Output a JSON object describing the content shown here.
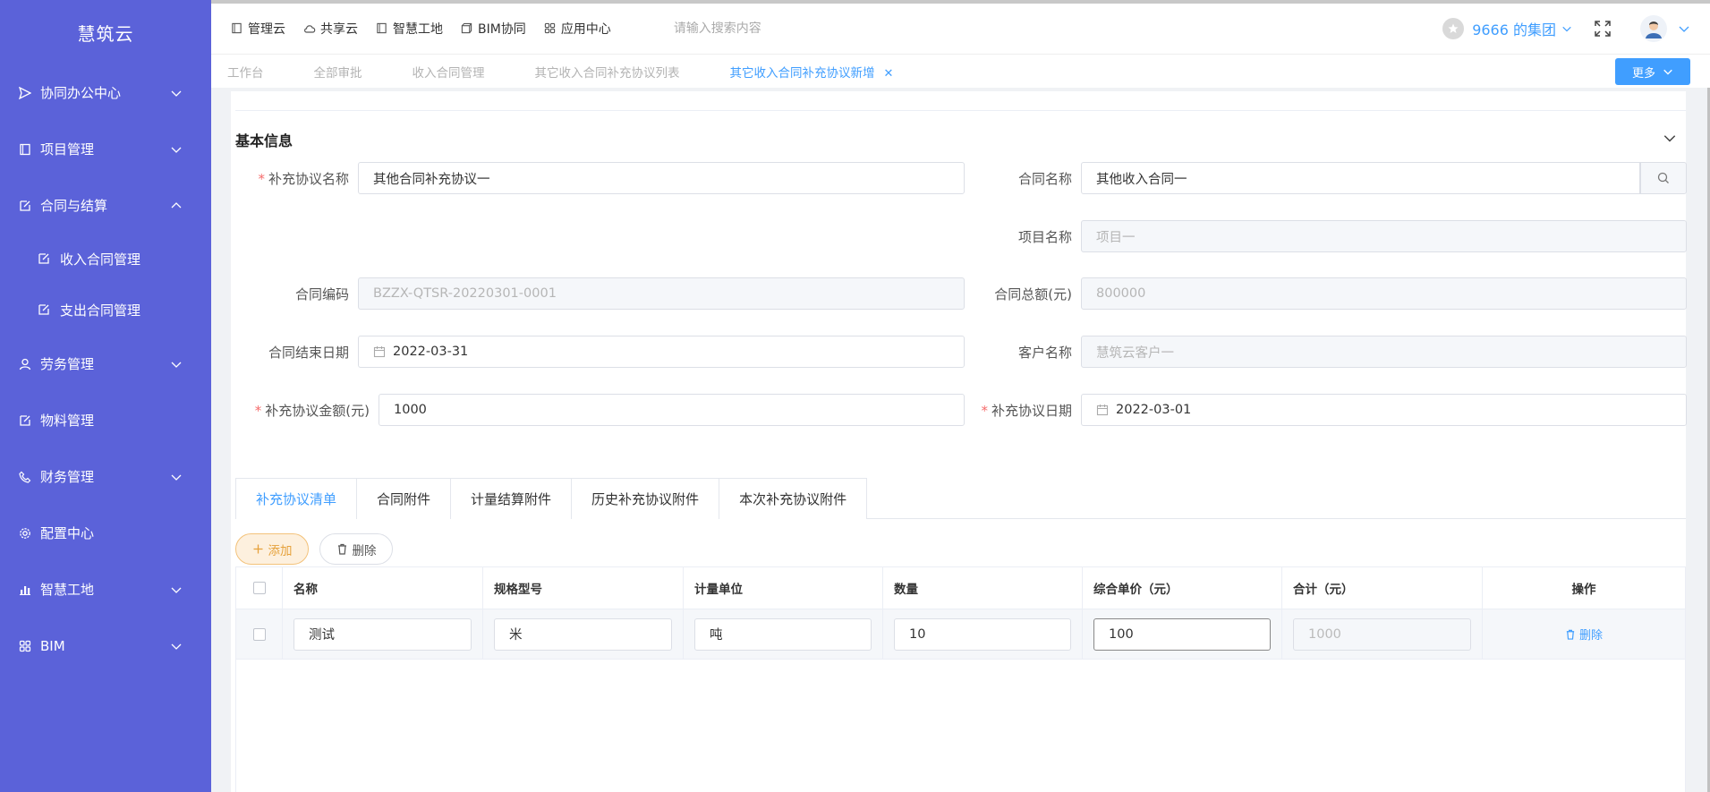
{
  "app": {
    "brand": "慧筑云"
  },
  "sidebar": {
    "items": [
      {
        "label": "协同办公中心",
        "icon": "send-icon",
        "expandable": true
      },
      {
        "label": "项目管理",
        "icon": "book-icon",
        "expandable": true
      },
      {
        "label": "合同与结算",
        "icon": "edit-doc-icon",
        "expandable": true,
        "expanded": true,
        "children": [
          {
            "label": "收入合同管理",
            "icon": "edit-doc-icon"
          },
          {
            "label": "支出合同管理",
            "icon": "edit-doc-icon"
          }
        ]
      },
      {
        "label": "劳务管理",
        "icon": "worker-icon",
        "expandable": true
      },
      {
        "label": "物料管理",
        "icon": "edit-doc-icon",
        "expandable": false
      },
      {
        "label": "财务管理",
        "icon": "phone-icon",
        "expandable": true
      },
      {
        "label": "配置中心",
        "icon": "gear-icon",
        "expandable": false
      },
      {
        "label": "智慧工地",
        "icon": "bar-chart-icon",
        "expandable": true
      },
      {
        "label": "BIM",
        "icon": "grid-icon",
        "expandable": true
      }
    ]
  },
  "header": {
    "nav": [
      {
        "label": "管理云",
        "icon": "book-icon"
      },
      {
        "label": "共享云",
        "icon": "cloud-icon"
      },
      {
        "label": "智慧工地",
        "icon": "book-icon"
      },
      {
        "label": "BIM协同",
        "icon": "cube-icon"
      },
      {
        "label": "应用中心",
        "icon": "grid-icon"
      }
    ],
    "search_placeholder": "请输入搜索内容",
    "group": "9666 的集团"
  },
  "tabs": [
    {
      "label": "工作台",
      "active": false
    },
    {
      "label": "全部审批",
      "active": false
    },
    {
      "label": "收入合同管理",
      "active": false
    },
    {
      "label": "其它收入合同补充协议列表",
      "active": false
    },
    {
      "label": "其它收入合同补充协议新增",
      "active": true,
      "closable": true
    }
  ],
  "more_label": "更多",
  "form": {
    "section_title": "基本信息",
    "supp_name": {
      "label": "补充协议名称",
      "value": "其他合同补充协议一",
      "required": true
    },
    "contract_name": {
      "label": "合同名称",
      "value": "其他收入合同一"
    },
    "project_name": {
      "label": "项目名称",
      "value": "项目一"
    },
    "contract_code": {
      "label": "合同编码",
      "value": "BZZX-QTSR-20220301-0001"
    },
    "contract_total": {
      "label": "合同总额(元)",
      "value": "800000"
    },
    "end_date": {
      "label": "合同结束日期",
      "value": "2022-03-31"
    },
    "customer": {
      "label": "客户名称",
      "value": "慧筑云客户一"
    },
    "supp_amount": {
      "label": "补充协议金额(元)",
      "value": "1000",
      "required": true
    },
    "supp_date": {
      "label": "补充协议日期",
      "value": "2022-03-01",
      "required": true
    }
  },
  "subtabs": [
    {
      "label": "补充协议清单",
      "active": true
    },
    {
      "label": "合同附件",
      "active": false
    },
    {
      "label": "计量结算附件",
      "active": false
    },
    {
      "label": "历史补充协议附件",
      "active": false
    },
    {
      "label": "本次补充协议附件",
      "active": false
    }
  ],
  "actions": {
    "add": "添加",
    "delete": "删除"
  },
  "table": {
    "columns": [
      "名称",
      "规格型号",
      "计量单位",
      "数量",
      "综合单价（元）",
      "合计（元）",
      "操作"
    ],
    "rows": [
      {
        "name": "测试",
        "spec": "米",
        "unit": "吨",
        "qty": "10",
        "price": "100",
        "total": "1000",
        "op": "删除"
      }
    ]
  },
  "colors": {
    "sidebar": "#5b62d9",
    "primary": "#409eff",
    "warning": "#e6a23c",
    "required": "#f56c6c"
  }
}
